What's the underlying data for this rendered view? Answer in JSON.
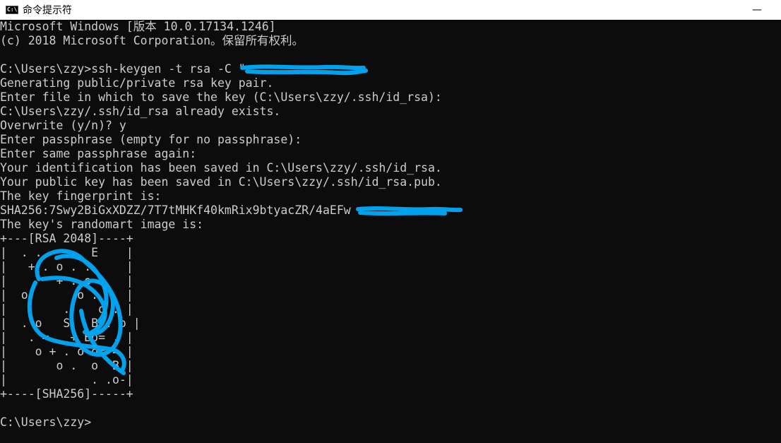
{
  "window": {
    "title": "命令提示符",
    "icon": "cmd-icon",
    "minimize_symbol": "—"
  },
  "console": {
    "lines": [
      "Microsoft Windows [版本 10.0.17134.1246]",
      "(c) 2018 Microsoft Corporation。保留所有权利。",
      "",
      "C:\\Users\\zzy>ssh-keygen -t rsa -C \"",
      "Generating public/private rsa key pair.",
      "Enter file in which to save the key (C:\\Users\\zzy/.ssh/id_rsa):",
      "C:\\Users\\zzy/.ssh/id_rsa already exists.",
      "Overwrite (y/n)? y",
      "Enter passphrase (empty for no passphrase):",
      "Enter same passphrase again:",
      "Your identification has been saved in C:\\Users\\zzy/.ssh/id_rsa.",
      "Your public key has been saved in C:\\Users\\zzy/.ssh/id_rsa.pub.",
      "The key fingerprint is:",
      "SHA256:7Swy2BiGxXDZZ/7T7tMHKf40kmRix9btyacZR/4aEFw",
      "The key's randomart image is:",
      "+---[RSA 2048]----+",
      "|  . .       E    |",
      "|   + . o . .     |",
      "|       + . o     |",
      "|  o       o .    |",
      "|        . .  o . |",
      "|  . o   S.  B . o |",
      "|   . =   + Bo= . |",
      "|    o + . o o= = |",
      "|       o .  o  B |",
      "|            . .o-|",
      "+----[SHA256]-----+",
      "",
      "C:\\Users\\zzy>"
    ],
    "redaction_color": "#00a2ed"
  }
}
